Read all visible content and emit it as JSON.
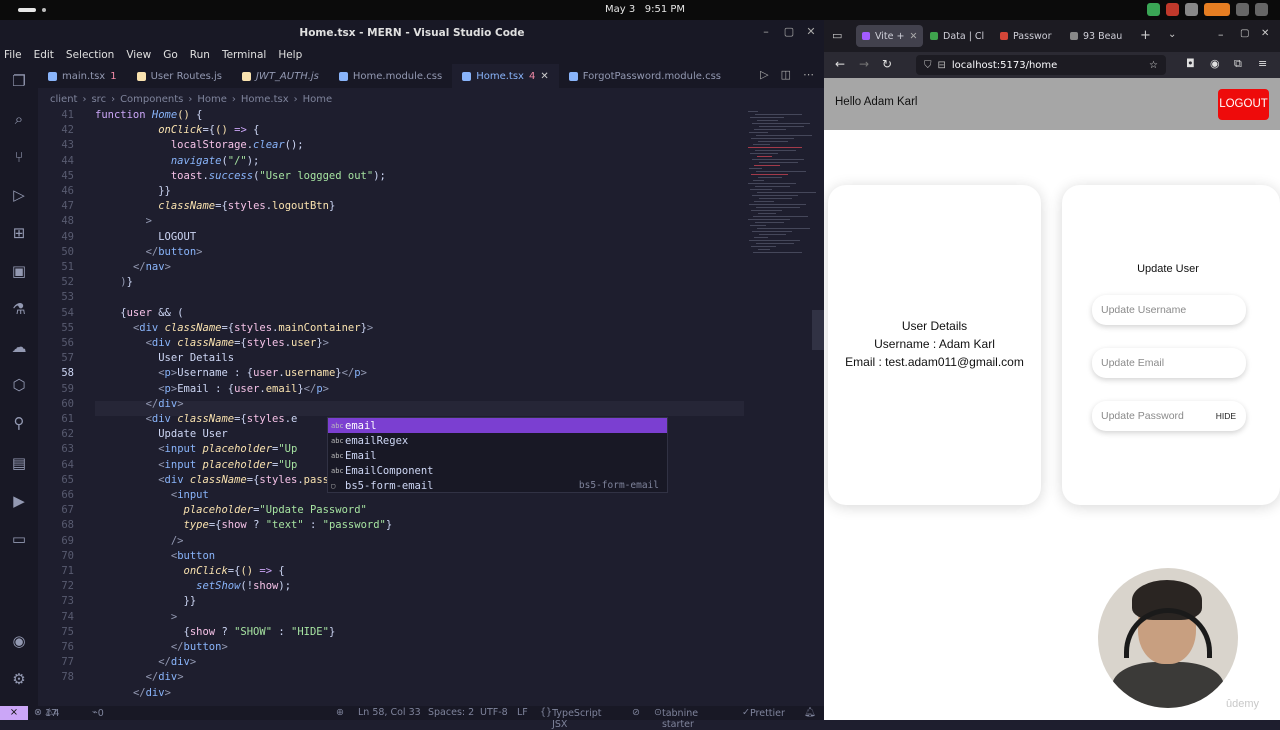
{
  "system": {
    "date": "May 3",
    "time": "9:51 PM"
  },
  "vscode": {
    "title": "Home.tsx - MERN - Visual Studio Code",
    "menu": [
      "File",
      "Edit",
      "Selection",
      "View",
      "Go",
      "Run",
      "Terminal",
      "Help"
    ],
    "tabs": [
      {
        "label": "main.tsx",
        "badge": "1",
        "color": "#89b4fa",
        "active": false
      },
      {
        "label": "User Routes.js",
        "badge": "",
        "color": "#f9e2af",
        "active": false
      },
      {
        "label": "JWT_AUTH.js",
        "badge": "",
        "color": "#f9e2af",
        "active": false
      },
      {
        "label": "Home.module.css",
        "badge": "",
        "color": "#89b4fa",
        "active": false
      },
      {
        "label": "Home.tsx",
        "badge": "4",
        "color": "#89b4fa",
        "active": true
      },
      {
        "label": "ForgotPassword.module.css",
        "badge": "",
        "color": "#89b4fa",
        "active": false
      }
    ],
    "breadcrumb": [
      "client",
      "src",
      "Components",
      "Home",
      "Home.tsx",
      "Home"
    ],
    "current_line": "58",
    "line_numbers": [
      "41",
      "42",
      "43",
      "44",
      "45",
      "46",
      "47",
      "48",
      "49",
      "50",
      "51",
      "52",
      "53",
      "54",
      "55",
      "56",
      "57",
      "58",
      "59",
      "60",
      "61",
      "62",
      "63",
      "64",
      "65",
      "66",
      "67",
      "68",
      "69",
      "70",
      "71",
      "72",
      "73",
      "74",
      "75",
      "76",
      "77",
      "78"
    ],
    "autocomplete": [
      {
        "label": "email",
        "detail": "",
        "selected": true
      },
      {
        "label": "emailRegex",
        "detail": "",
        "selected": false
      },
      {
        "label": "Email",
        "detail": "",
        "selected": false
      },
      {
        "label": "EmailComponent",
        "detail": "",
        "selected": false
      },
      {
        "label": "bs5-form-email",
        "detail": "bs5-form-email",
        "selected": false
      }
    ],
    "status": {
      "errors": "17",
      "warnings": "4",
      "ports": "0",
      "position": "Ln 58, Col 33",
      "spaces": "Spaces: 2",
      "encoding": "UTF-8",
      "eol": "LF",
      "language": "TypeScript JSX",
      "tabnine": "tabnine starter",
      "prettier": "Prettier"
    }
  },
  "browser": {
    "tabs": [
      "Vite +",
      "Data | Cl",
      "Passwor",
      "93 Beau"
    ],
    "url": "localhost:5173/home",
    "page": {
      "greeting": "Hello Adam Karl",
      "logout_label": "LOGOUT",
      "details_heading": "User Details",
      "username_line": "Username : Adam Karl",
      "email_line": "Email : test.adam011@gmail.com",
      "update_heading": "Update User",
      "username_placeholder": "Update Username",
      "email_placeholder": "Update Email",
      "password_placeholder": "Update Password",
      "toggle_label": "HIDE"
    }
  },
  "watermark": "ûdemy"
}
